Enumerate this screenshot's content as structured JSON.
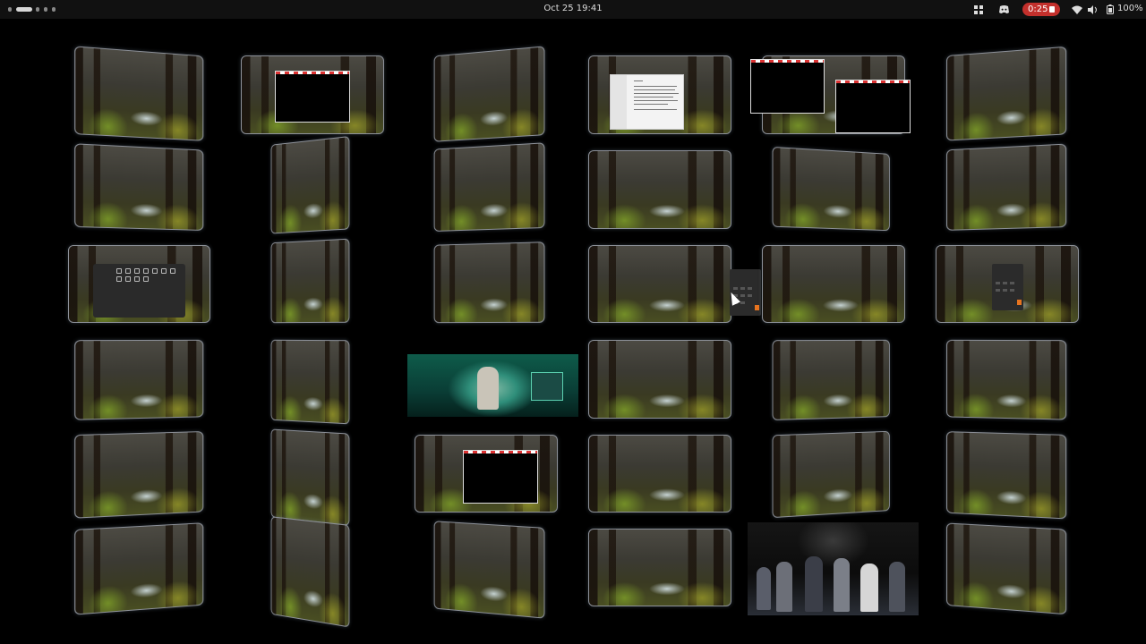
{
  "topbar": {
    "datetime": "Oct 25  19:41",
    "recording_timer": "0:25",
    "battery_percent": "100%",
    "workspace_indicators": [
      "active",
      "inactive",
      "inactive",
      "inactive"
    ],
    "tray_icons": [
      "extension-icon",
      "discord-icon",
      "wifi-icon",
      "volume-icon",
      "battery-icon"
    ]
  },
  "wall": {
    "description_wallpaper": "forest-stream",
    "highlighted_apps": [
      "terminal-window",
      "text-editor",
      "terminal-window",
      "terminal-window",
      "settings-window",
      "calculator",
      "calculator",
      "video-player",
      "terminal-window",
      "video-player"
    ]
  },
  "colors": {
    "accent_record": "#c3302c",
    "tile_border": "#8c9098",
    "calc_accent": "#e8741f"
  }
}
